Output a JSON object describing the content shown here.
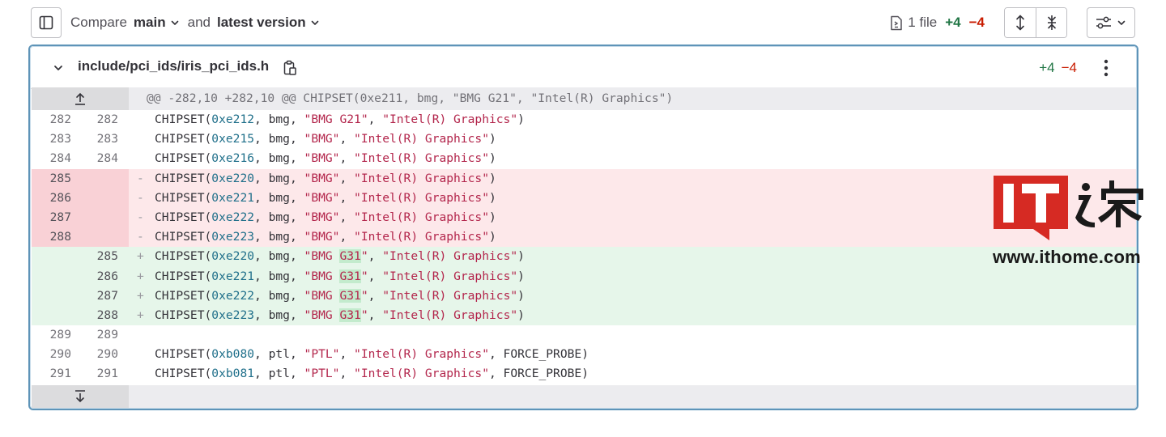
{
  "toolbar": {
    "compare_label": "Compare",
    "source_branch": "main",
    "and_label": "and",
    "target_version": "latest version",
    "file_count": "1 file",
    "added_total": "+4",
    "removed_total": "−4"
  },
  "file": {
    "path": "include/pci_ids/iris_pci_ids.h",
    "added": "+4",
    "removed": "−4"
  },
  "hunk_header": "@@ -282,10 +282,10 @@ CHIPSET(0xe211, bmg, \"BMG G21\", \"Intel(R) Graphics\")",
  "lines": [
    {
      "type": "ctx",
      "old": "282",
      "new": "282",
      "sign": "",
      "pre": "CHIPSET(",
      "hex": "0xe212",
      "mid": ", bmg, ",
      "s1a": "\"BMG G21\"",
      "s1hl": "",
      "s1b": "",
      "sep": ", ",
      "s2": "\"Intel(R) Graphics\"",
      "tail": ")"
    },
    {
      "type": "ctx",
      "old": "283",
      "new": "283",
      "sign": "",
      "pre": "CHIPSET(",
      "hex": "0xe215",
      "mid": ", bmg, ",
      "s1a": "\"BMG\"",
      "s1hl": "",
      "s1b": "",
      "sep": ", ",
      "s2": "\"Intel(R) Graphics\"",
      "tail": ")"
    },
    {
      "type": "ctx",
      "old": "284",
      "new": "284",
      "sign": "",
      "pre": "CHIPSET(",
      "hex": "0xe216",
      "mid": ", bmg, ",
      "s1a": "\"BMG\"",
      "s1hl": "",
      "s1b": "",
      "sep": ", ",
      "s2": "\"Intel(R) Graphics\"",
      "tail": ")"
    },
    {
      "type": "old",
      "old": "285",
      "new": "",
      "sign": "-",
      "pre": "CHIPSET(",
      "hex": "0xe220",
      "mid": ", bmg, ",
      "s1a": "\"BMG\"",
      "s1hl": "",
      "s1b": "",
      "sep": ", ",
      "s2": "\"Intel(R) Graphics\"",
      "tail": ")"
    },
    {
      "type": "old",
      "old": "286",
      "new": "",
      "sign": "-",
      "pre": "CHIPSET(",
      "hex": "0xe221",
      "mid": ", bmg, ",
      "s1a": "\"BMG\"",
      "s1hl": "",
      "s1b": "",
      "sep": ", ",
      "s2": "\"Intel(R) Graphics\"",
      "tail": ")"
    },
    {
      "type": "old",
      "old": "287",
      "new": "",
      "sign": "-",
      "pre": "CHIPSET(",
      "hex": "0xe222",
      "mid": ", bmg, ",
      "s1a": "\"BMG\"",
      "s1hl": "",
      "s1b": "",
      "sep": ", ",
      "s2": "\"Intel(R) Graphics\"",
      "tail": ")"
    },
    {
      "type": "old",
      "old": "288",
      "new": "",
      "sign": "-",
      "pre": "CHIPSET(",
      "hex": "0xe223",
      "mid": ", bmg, ",
      "s1a": "\"BMG\"",
      "s1hl": "",
      "s1b": "",
      "sep": ", ",
      "s2": "\"Intel(R) Graphics\"",
      "tail": ")"
    },
    {
      "type": "new",
      "old": "",
      "new": "285",
      "sign": "+",
      "pre": "CHIPSET(",
      "hex": "0xe220",
      "mid": ", bmg, ",
      "s1a": "\"BMG ",
      "s1hl": "G31",
      "s1b": "\"",
      "sep": ", ",
      "s2": "\"Intel(R) Graphics\"",
      "tail": ")"
    },
    {
      "type": "new",
      "old": "",
      "new": "286",
      "sign": "+",
      "pre": "CHIPSET(",
      "hex": "0xe221",
      "mid": ", bmg, ",
      "s1a": "\"BMG ",
      "s1hl": "G31",
      "s1b": "\"",
      "sep": ", ",
      "s2": "\"Intel(R) Graphics\"",
      "tail": ")"
    },
    {
      "type": "new",
      "old": "",
      "new": "287",
      "sign": "+",
      "pre": "CHIPSET(",
      "hex": "0xe222",
      "mid": ", bmg, ",
      "s1a": "\"BMG ",
      "s1hl": "G31",
      "s1b": "\"",
      "sep": ", ",
      "s2": "\"Intel(R) Graphics\"",
      "tail": ")"
    },
    {
      "type": "new",
      "old": "",
      "new": "288",
      "sign": "+",
      "pre": "CHIPSET(",
      "hex": "0xe223",
      "mid": ", bmg, ",
      "s1a": "\"BMG ",
      "s1hl": "G31",
      "s1b": "\"",
      "sep": ", ",
      "s2": "\"Intel(R) Graphics\"",
      "tail": ")"
    },
    {
      "type": "ctx",
      "old": "289",
      "new": "289",
      "sign": "",
      "pre": "",
      "hex": "",
      "mid": "",
      "s1a": "",
      "s1hl": "",
      "s1b": "",
      "sep": "",
      "s2": "",
      "tail": ""
    },
    {
      "type": "ctx",
      "old": "290",
      "new": "290",
      "sign": "",
      "pre": "CHIPSET(",
      "hex": "0xb080",
      "mid": ", ptl, ",
      "s1a": "\"PTL\"",
      "s1hl": "",
      "s1b": "",
      "sep": ", ",
      "s2": "\"Intel(R) Graphics\"",
      "tail": ", FORCE_PROBE)"
    },
    {
      "type": "ctx",
      "old": "291",
      "new": "291",
      "sign": "",
      "pre": "CHIPSET(",
      "hex": "0xb081",
      "mid": ", ptl, ",
      "s1a": "\"PTL\"",
      "s1hl": "",
      "s1b": "",
      "sep": ", ",
      "s2": "\"Intel(R) Graphics\"",
      "tail": ", FORCE_PROBE)"
    }
  ],
  "watermark": {
    "logo_text": "IT之家",
    "url": "www.ithome.com"
  },
  "colors": {
    "accent_border": "#5e94b8",
    "added": "#217645",
    "removed": "#c91c00",
    "old_line_bg": "#fde8ea",
    "new_line_bg": "#e6f6ea",
    "watermark_red": "#d62a23"
  },
  "icons": [
    "sidebar-toggle-icon",
    "chevron-down-icon",
    "file-diff-icon",
    "expand-all-icon",
    "collapse-all-icon",
    "preferences-icon",
    "copy-path-icon",
    "kebab-menu-icon",
    "expand-up-icon",
    "expand-down-icon"
  ]
}
